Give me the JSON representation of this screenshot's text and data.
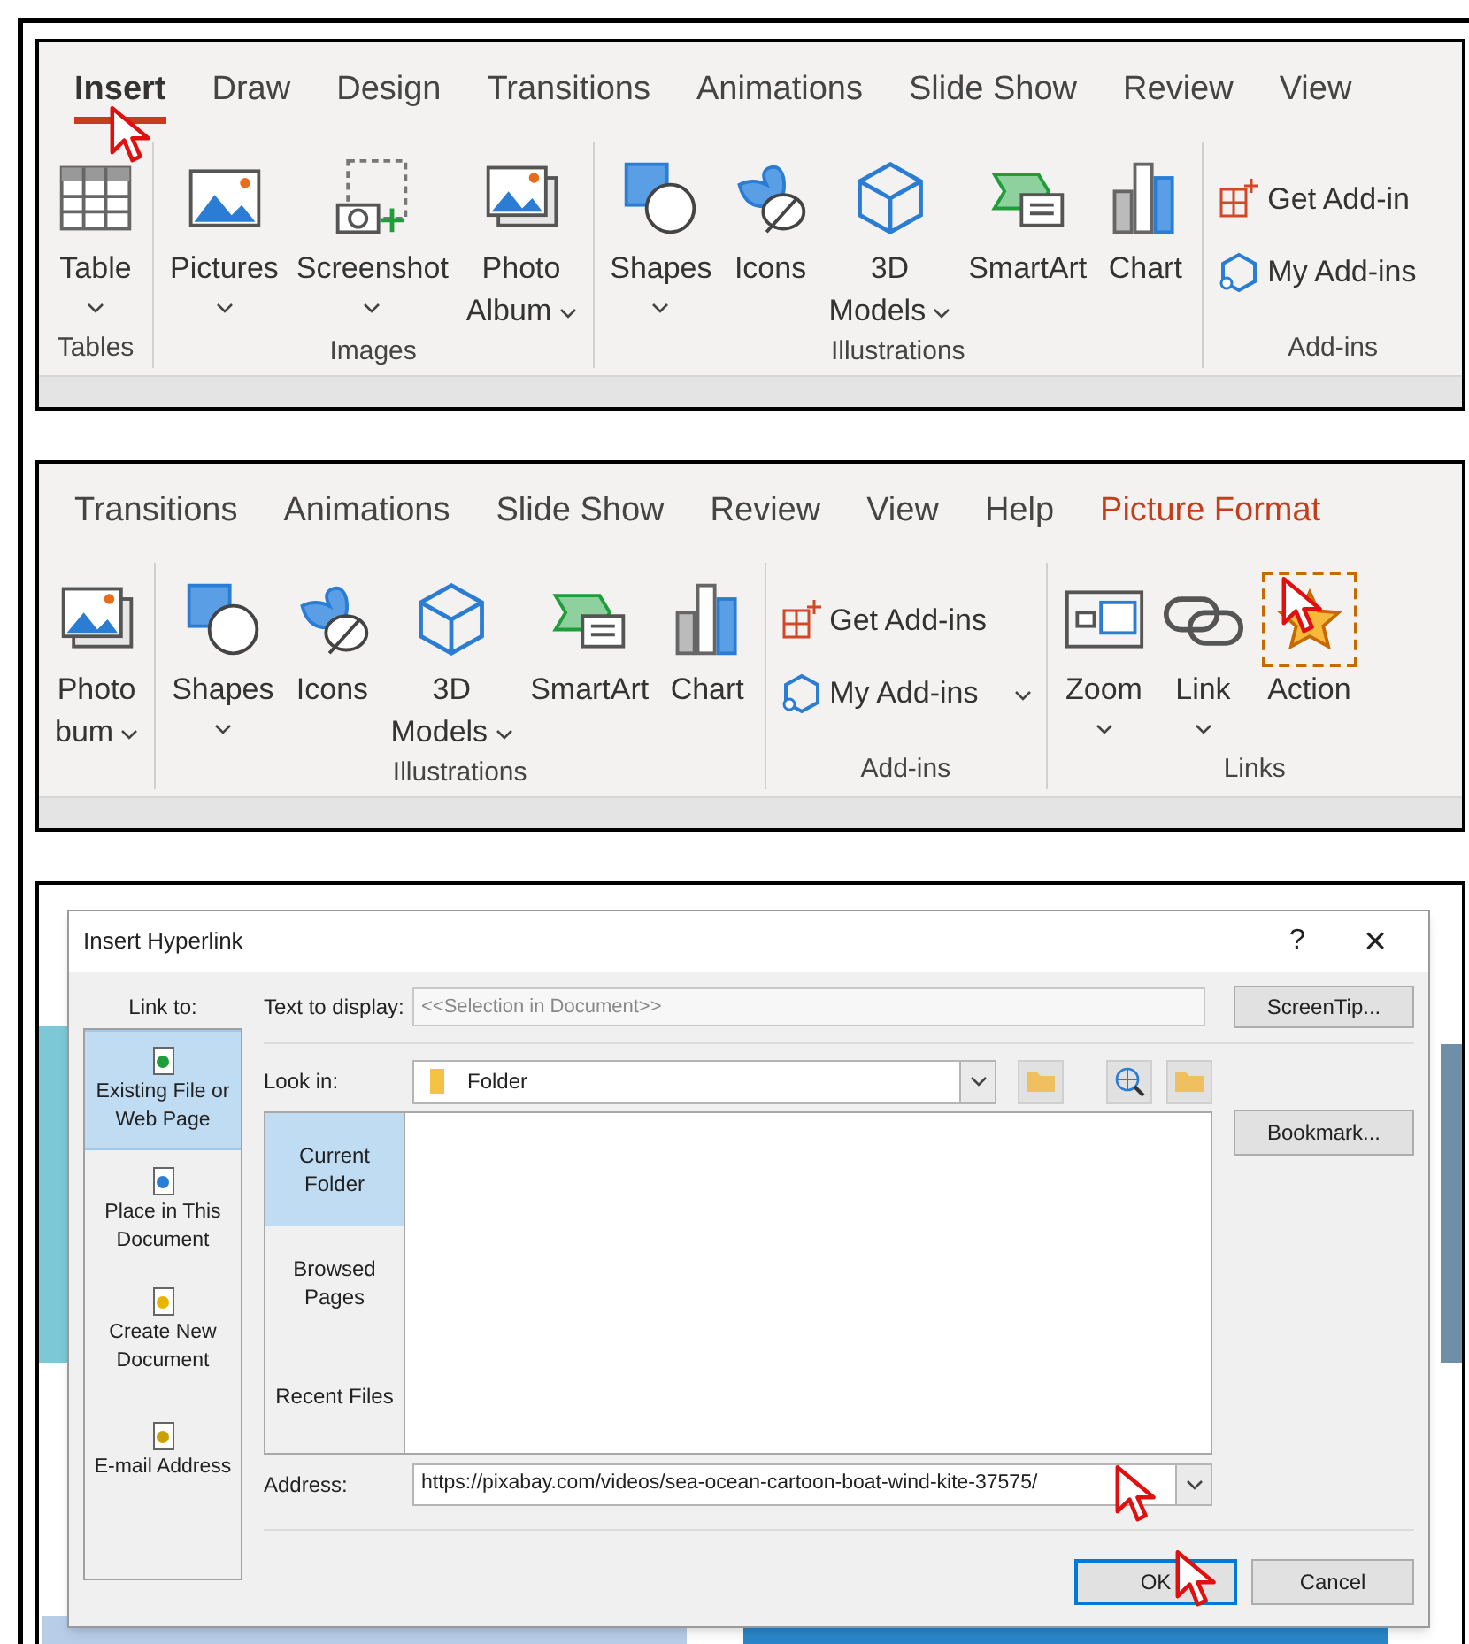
{
  "ribbon_insert": {
    "tabs": [
      {
        "label": "Insert",
        "selected": true,
        "contextual": false
      },
      {
        "label": "Draw",
        "selected": false,
        "contextual": false
      },
      {
        "label": "Design",
        "selected": false,
        "contextual": false
      },
      {
        "label": "Transitions",
        "selected": false,
        "contextual": false
      },
      {
        "label": "Animations",
        "selected": false,
        "contextual": false
      },
      {
        "label": "Slide Show",
        "selected": false,
        "contextual": false
      },
      {
        "label": "Review",
        "selected": false,
        "contextual": false
      },
      {
        "label": "View",
        "selected": false,
        "contextual": false
      }
    ],
    "groups": [
      {
        "label": "Tables",
        "buttons": [
          {
            "kind": "table",
            "lines": [
              "Table"
            ],
            "dropdown": true
          }
        ]
      },
      {
        "label": "Images",
        "buttons": [
          {
            "kind": "pictures",
            "lines": [
              "Pictures"
            ],
            "dropdown": true
          },
          {
            "kind": "screenshot",
            "lines": [
              "Screenshot"
            ],
            "dropdown": true
          },
          {
            "kind": "album",
            "lines": [
              "Photo",
              "Album"
            ],
            "dropdown": true
          }
        ]
      },
      {
        "label": "Illustrations",
        "buttons": [
          {
            "kind": "shapes",
            "lines": [
              "Shapes"
            ],
            "dropdown": true
          },
          {
            "kind": "icons",
            "lines": [
              "Icons"
            ],
            "dropdown": false
          },
          {
            "kind": "models",
            "lines": [
              "3D",
              "Models"
            ],
            "dropdown": true
          },
          {
            "kind": "smartart",
            "lines": [
              "SmartArt"
            ],
            "dropdown": false
          },
          {
            "kind": "chart",
            "lines": [
              "Chart"
            ],
            "dropdown": false
          }
        ]
      },
      {
        "label": "Add-ins",
        "buttons": [
          {
            "kind": "getaddins",
            "lines": [
              "Get Add-in"
            ],
            "dropdown": false
          },
          {
            "kind": "myaddins",
            "lines": [
              "My Add-ins"
            ],
            "dropdown": false
          }
        ]
      }
    ]
  },
  "ribbon_format": {
    "tabs": [
      {
        "label": "Transitions",
        "selected": false,
        "contextual": false
      },
      {
        "label": "Animations",
        "selected": false,
        "contextual": false
      },
      {
        "label": "Slide Show",
        "selected": false,
        "contextual": false
      },
      {
        "label": "Review",
        "selected": false,
        "contextual": false
      },
      {
        "label": "View",
        "selected": false,
        "contextual": false
      },
      {
        "label": "Help",
        "selected": false,
        "contextual": false
      },
      {
        "label": "Picture Format",
        "selected": false,
        "contextual": true
      }
    ],
    "groups": [
      {
        "buttons": [
          {
            "kind": "album",
            "lines": [
              "Photo",
              "bum"
            ],
            "dropdown": true
          }
        ]
      },
      {
        "label": "Illustrations",
        "buttons": [
          {
            "kind": "shapes",
            "lines": [
              "Shapes"
            ],
            "dropdown": true
          },
          {
            "kind": "icons",
            "lines": [
              "Icons"
            ],
            "dropdown": false
          },
          {
            "kind": "models",
            "lines": [
              "3D",
              "Models"
            ],
            "dropdown": true
          },
          {
            "kind": "smartart",
            "lines": [
              "SmartArt"
            ],
            "dropdown": false
          },
          {
            "kind": "chart",
            "lines": [
              "Chart"
            ],
            "dropdown": false
          }
        ]
      },
      {
        "label": "Add-ins",
        "buttons": [
          {
            "kind": "getaddins",
            "lines": [
              "Get Add-ins"
            ],
            "dropdown": false
          },
          {
            "kind": "myaddins",
            "lines": [
              "My Add-ins"
            ],
            "dropdown": true
          }
        ]
      },
      {
        "label": "Links",
        "buttons": [
          {
            "kind": "zoom",
            "lines": [
              "Zoom"
            ],
            "dropdown": true
          },
          {
            "kind": "link",
            "lines": [
              "Link"
            ],
            "dropdown": true
          },
          {
            "kind": "action",
            "lines": [
              "Action"
            ],
            "dropdown": false,
            "highlighted": true
          }
        ]
      }
    ]
  },
  "dialog": {
    "title": "Insert Hyperlink",
    "help": "?",
    "close": "×",
    "link_to_label": "Link to:",
    "link_to": [
      {
        "kind": "file",
        "lines": [
          "Existing File or",
          "Web Page"
        ],
        "selected": true
      },
      {
        "kind": "place",
        "lines": [
          "Place in This",
          "Document"
        ],
        "selected": false
      },
      {
        "kind": "new",
        "lines": [
          "Create New",
          "Document"
        ],
        "selected": false
      },
      {
        "kind": "email",
        "lines": [
          "E-mail Address"
        ],
        "selected": false
      }
    ],
    "text_to_display": {
      "label": "Text to display:",
      "placeholder": "<<Selection in Document>>"
    },
    "screentip": "ScreenTip...",
    "look_in": {
      "label": "Look in:",
      "value": "Folder"
    },
    "bookmark": "Bookmark...",
    "nav": [
      {
        "lines": [
          "Current",
          "Folder"
        ],
        "selected": true
      },
      {
        "lines": [
          "Browsed",
          "Pages"
        ],
        "selected": false
      },
      {
        "lines": [
          "Recent Files"
        ],
        "selected": false
      }
    ],
    "address": {
      "label": "Address:",
      "value": "https://pixabay.com/videos/sea-ocean-cartoon-boat-wind-kite-37575/"
    },
    "ok": "OK",
    "cancel": "Cancel"
  }
}
